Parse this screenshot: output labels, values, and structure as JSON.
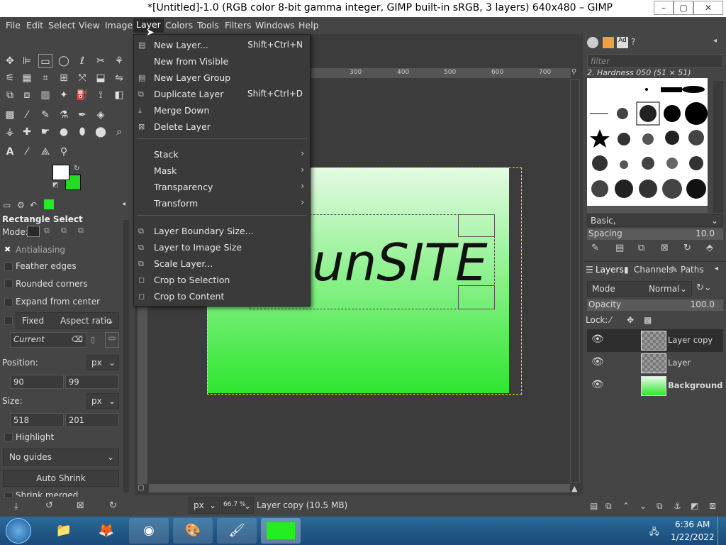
{
  "window": {
    "title": "*[Untitled]-1.0 (RGB color 8-bit gamma integer, GIMP built-in sRGB, 3 layers) 640x480 – GIMP",
    "minimize": "–",
    "maximize": "▢",
    "close": "✕"
  },
  "menubar": [
    "File",
    "Edit",
    "Select",
    "View",
    "Image",
    "Layer",
    "Colors",
    "Tools",
    "Filters",
    "Windows",
    "Help"
  ],
  "layer_menu": {
    "items": [
      {
        "label": "New Layer...",
        "shortcut": "Shift+Ctrl+N",
        "icon": "new-layer-icon"
      },
      {
        "label": "New from Visible",
        "shortcut": "",
        "icon": ""
      },
      {
        "label": "New Layer Group",
        "shortcut": "",
        "icon": "layer-group-icon"
      },
      {
        "label": "Duplicate Layer",
        "shortcut": "Shift+Ctrl+D",
        "icon": "duplicate-icon"
      },
      {
        "label": "Merge Down",
        "shortcut": "",
        "icon": "merge-down-icon"
      },
      {
        "label": "Delete Layer",
        "shortcut": "",
        "icon": "delete-icon"
      }
    ],
    "submenus": [
      "Stack",
      "Mask",
      "Transparency",
      "Transform"
    ],
    "items2": [
      {
        "label": "Layer Boundary Size...",
        "icon": "boundary-size-icon"
      },
      {
        "label": "Layer to Image Size",
        "icon": "layer-to-image-icon"
      },
      {
        "label": "Scale Layer...",
        "icon": "scale-icon"
      },
      {
        "label": "Crop to Selection",
        "icon": "crop-icon"
      },
      {
        "label": "Crop to Content",
        "icon": "crop-content-icon"
      }
    ]
  },
  "tool_options": {
    "title": "Rectangle Select",
    "mode_label": "Mode:",
    "antialiasing": "Antialiasing",
    "feather": "Feather edges",
    "rounded": "Rounded corners",
    "expand": "Expand from center",
    "fixed": "Fixed",
    "aspect": "Aspect ratio",
    "current": "Current",
    "position_label": "Position:",
    "pos_unit": "px",
    "pos_x": "90",
    "pos_y": "99",
    "size_label": "Size:",
    "size_unit": "px",
    "size_w": "518",
    "size_h": "201",
    "highlight": "Highlight",
    "guides": "No guides",
    "auto_shrink": "Auto Shrink",
    "shrink_merged": "Shrink merged"
  },
  "canvas": {
    "text": "unSITE",
    "ruler_ticks": [
      "300",
      "400",
      "500",
      "600",
      "700"
    ]
  },
  "brushes": {
    "filter_placeholder": "filter",
    "selected": "2. Hardness 050 (51 × 51)",
    "preset": "Basic,",
    "spacing_label": "Spacing",
    "spacing_value": "10.0"
  },
  "layers_panel": {
    "tabs": [
      "Layers",
      "Channels",
      "Paths"
    ],
    "mode_label": "Mode",
    "mode_value": "Normal",
    "opacity_label": "Opacity",
    "opacity_value": "100.0",
    "lock_label": "Lock:",
    "layers": [
      {
        "name": "Layer copy",
        "bold": false
      },
      {
        "name": "Layer",
        "bold": false
      },
      {
        "name": "Background",
        "bold": true
      }
    ]
  },
  "statusbar": {
    "unit": "px",
    "zoom": "66.7 %",
    "info": "Layer copy (10.5 MB)"
  },
  "taskbar": {
    "time": "6:36 AM",
    "date": "1/22/2022"
  },
  "colors": {
    "fg": "#ffffff",
    "bg": "#22dd22"
  }
}
